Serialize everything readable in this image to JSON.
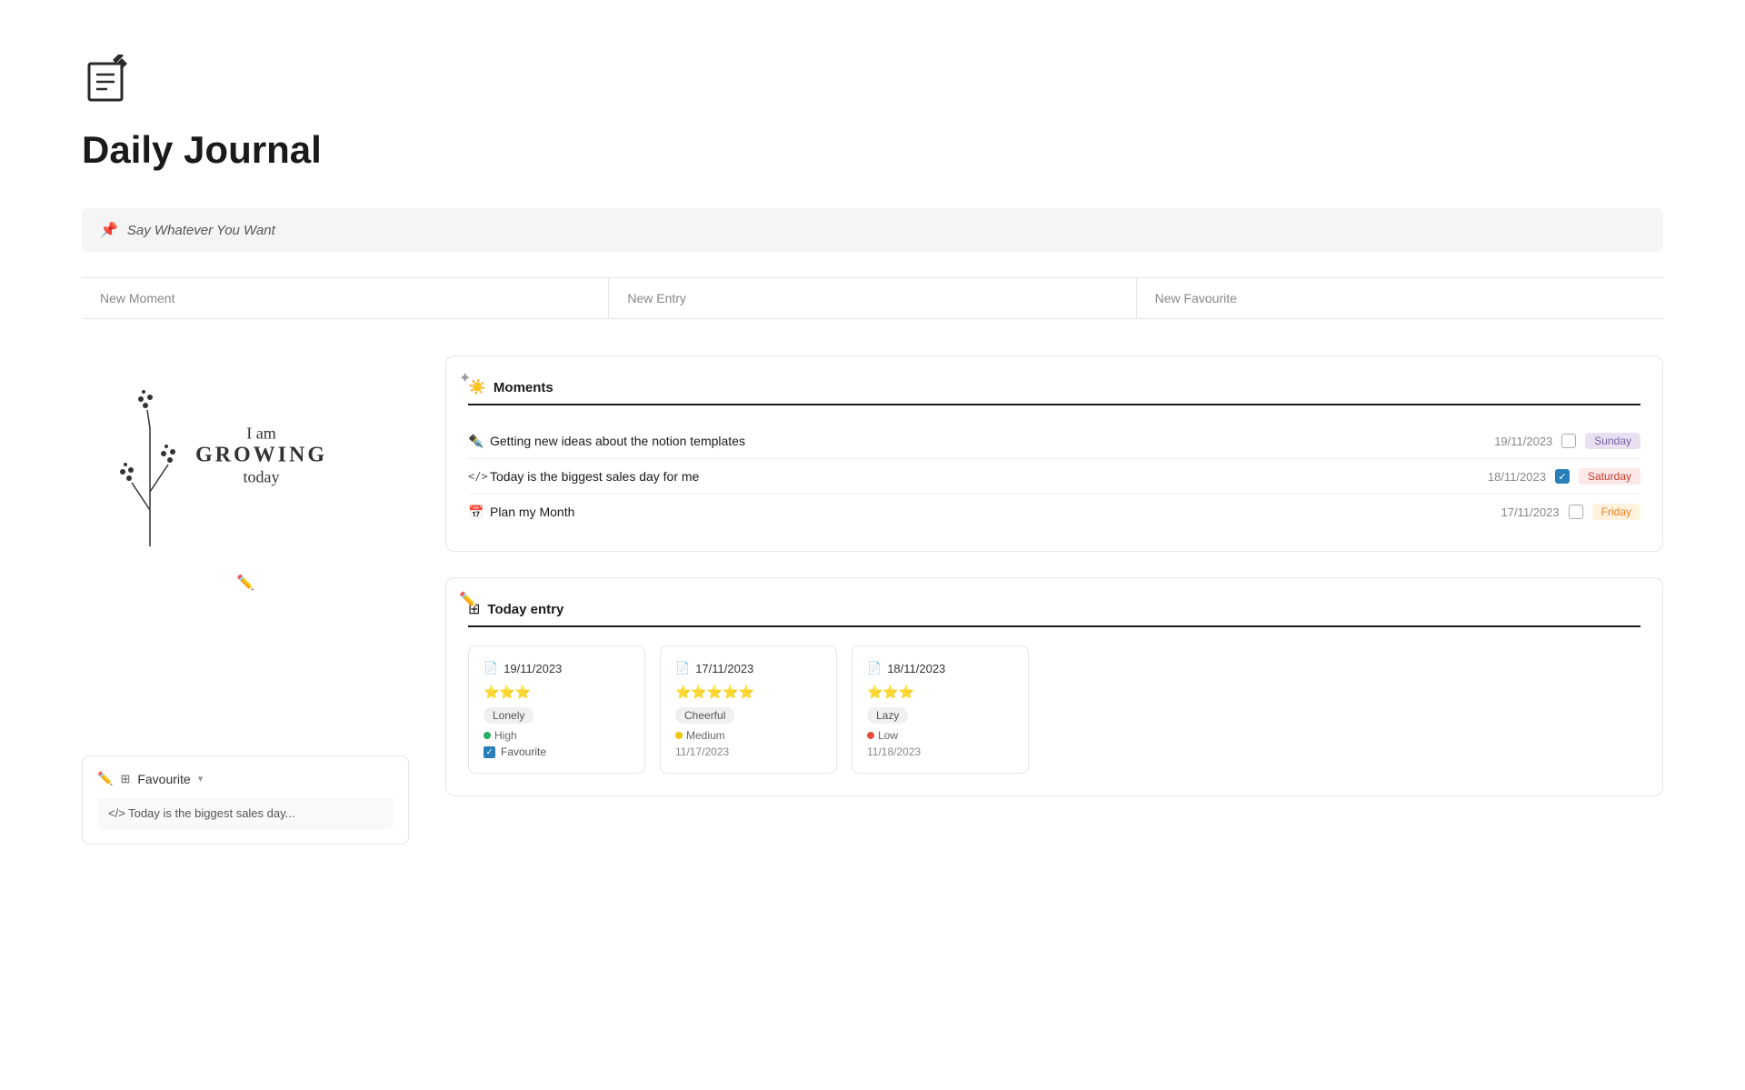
{
  "page": {
    "title": "Daily Journal",
    "icon_label": "journal-icon"
  },
  "pinned": {
    "text": "Say Whatever You Want"
  },
  "actions": {
    "new_moment": "New Moment",
    "new_entry": "New Entry",
    "new_favourite": "New Favourite"
  },
  "handwriting": {
    "line1": "I am",
    "line2": "GROWING",
    "line3": "today"
  },
  "favourite_section": {
    "label": "Favourite",
    "item_text": "</> Today is the biggest sales day..."
  },
  "moments_section": {
    "title": "Moments",
    "items": [
      {
        "icon": "✒️",
        "text": "Getting new ideas about the notion templates",
        "checked": false,
        "date": "19/11/2023",
        "day": "Sunday",
        "day_class": "day-sunday"
      },
      {
        "icon": "</>",
        "text": "Today is the biggest sales day for me",
        "checked": true,
        "date": "18/11/2023",
        "day": "Saturday",
        "day_class": "day-saturday"
      },
      {
        "icon": "📅",
        "text": "Plan my Month",
        "checked": false,
        "date": "17/11/2023",
        "day": "Friday",
        "day_class": "day-friday"
      }
    ]
  },
  "today_entry_section": {
    "title": "Today entry",
    "entries": [
      {
        "date": "19/11/2023",
        "stars": "⭐⭐⭐",
        "mood": "Lonely",
        "energy": "High",
        "energy_dot": "dot-green",
        "favourite": true,
        "entry_date": ""
      },
      {
        "date": "17/11/2023",
        "stars": "⭐⭐⭐⭐⭐",
        "mood": "Cheerful",
        "energy": "Medium",
        "energy_dot": "dot-yellow",
        "favourite": false,
        "entry_date": "11/17/2023"
      },
      {
        "date": "18/11/2023",
        "stars": "⭐⭐⭐",
        "mood": "Lazy",
        "energy": "Low",
        "energy_dot": "dot-red",
        "favourite": false,
        "entry_date": "11/18/2023"
      }
    ]
  }
}
